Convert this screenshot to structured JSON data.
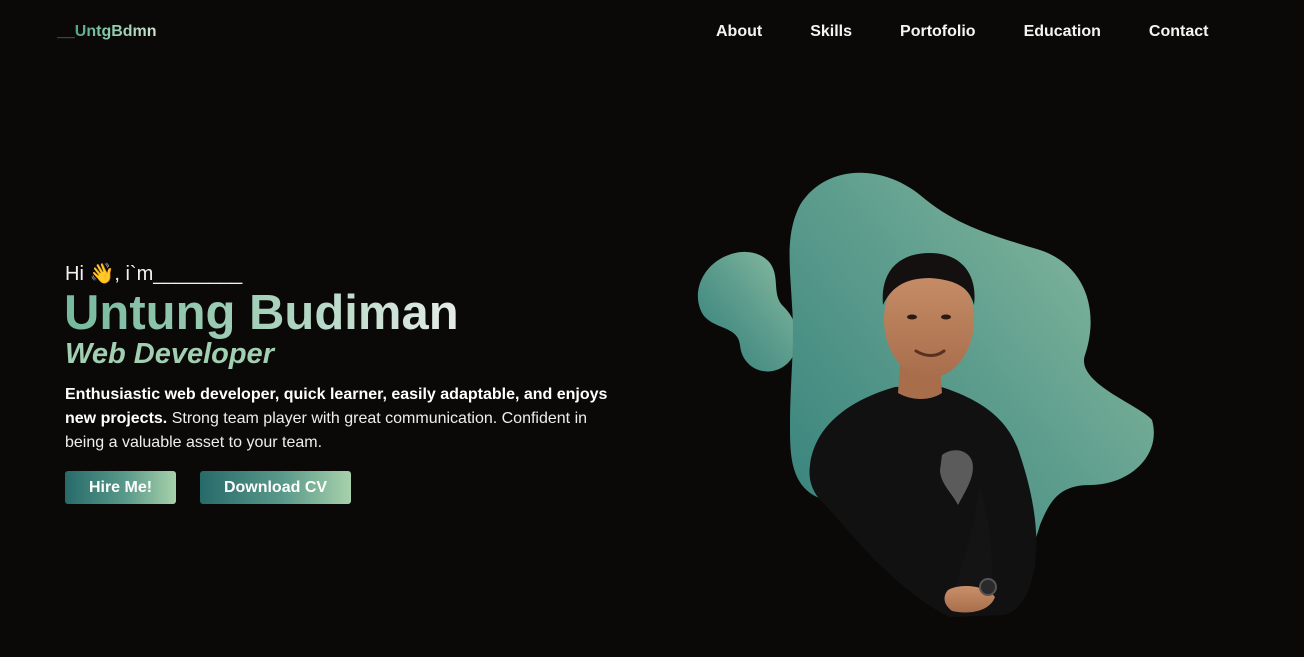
{
  "brand": {
    "logo": "__UntgBdmn"
  },
  "nav": {
    "items": [
      "About",
      "Skills",
      "Portofolio",
      "Education",
      "Contact"
    ]
  },
  "hero": {
    "greeting": "Hi 👋, i`m________",
    "name": "Untung Budiman",
    "role": "Web Developer",
    "description_bold": "Enthusiastic web developer, quick learner, easily adaptable, and enjoys new projects.",
    "description_rest": " Strong team player with great communication. Confident in being a valuable asset to your team.",
    "hire_label": "Hire Me!",
    "cv_label": "Download CV"
  },
  "theme": {
    "background": "#0b0908",
    "accent_dark": "#276a6a",
    "accent_light": "#a7d1ab",
    "blob": "#5f9e8e"
  },
  "image": {
    "subject": "portrait of a young man in a black t-shirt on a green blob shape"
  }
}
